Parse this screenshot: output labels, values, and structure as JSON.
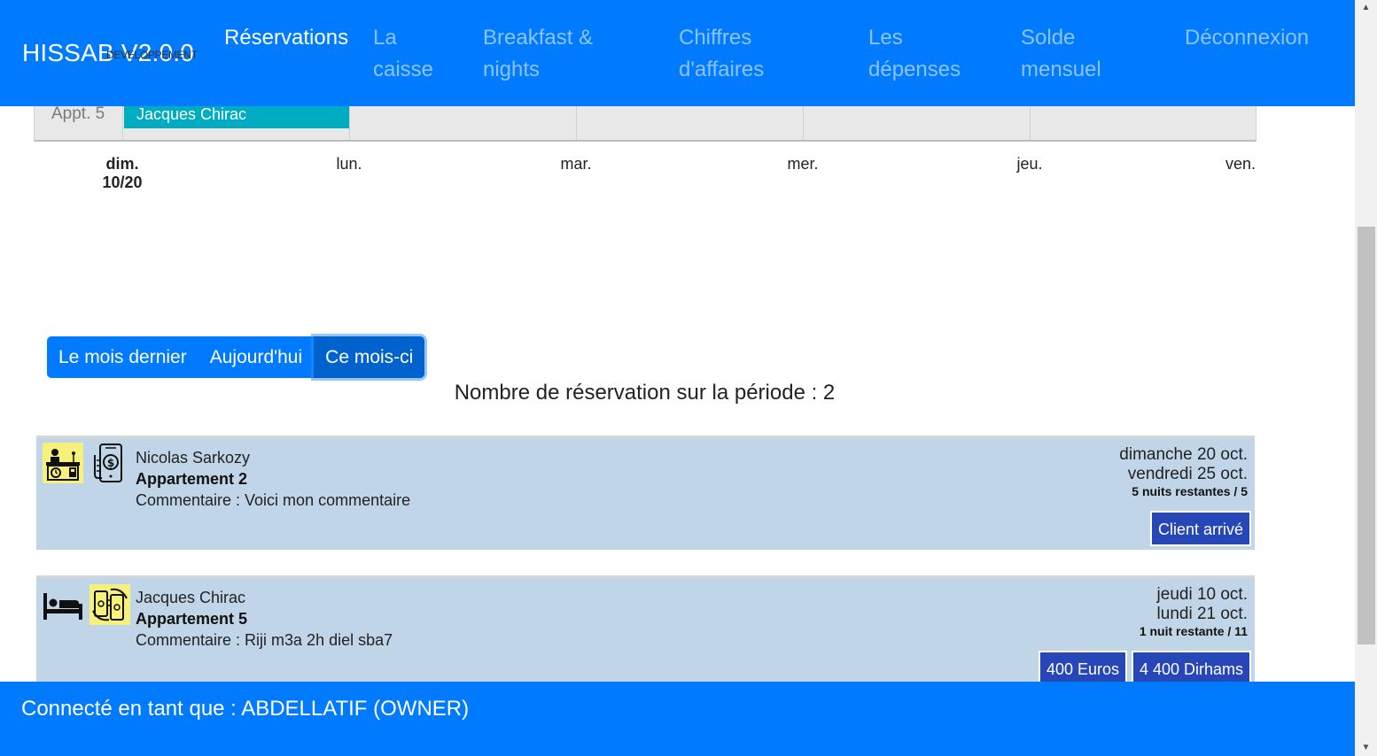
{
  "app": {
    "brand": "HISSAB V2.0.0",
    "brand_sub": "DEVELOPPEMENT"
  },
  "nav": {
    "items": [
      {
        "label_line1": "Réservations",
        "label_line2": ""
      },
      {
        "label_line1": "La",
        "label_line2": "caisse"
      },
      {
        "label_line1": "Breakfast &",
        "label_line2": "nights"
      },
      {
        "label_line1": "Chiffres",
        "label_line2": "d'affaires"
      },
      {
        "label_line1": "Les",
        "label_line2": "dépenses"
      },
      {
        "label_line1": "Solde",
        "label_line2": "mensuel"
      },
      {
        "label_line1": "Déconnexion",
        "label_line2": ""
      }
    ]
  },
  "timeline": {
    "row_label": "Appt. 5",
    "booking_label": "Jacques Chirac",
    "days": [
      {
        "name": "dim.",
        "date": "10/20"
      },
      {
        "name": "lun.",
        "date": ""
      },
      {
        "name": "mar.",
        "date": ""
      },
      {
        "name": "mer.",
        "date": ""
      },
      {
        "name": "jeu.",
        "date": ""
      },
      {
        "name": "ven.",
        "date": ""
      }
    ]
  },
  "period": {
    "buttons": [
      "Le mois dernier",
      "Aujourd'hui",
      "Ce mois-ci"
    ],
    "active": "Ce mois-ci",
    "count_text": "Nombre de réservation sur la période : 2"
  },
  "reservations": [
    {
      "client": "Nicolas Sarkozy",
      "apartment": "Appartement 2",
      "comment": "Commentaire : Voici mon commentaire",
      "start": "dimanche 20 oct.",
      "end": "vendredi 25 oct.",
      "nights": "5 nuits restantes / 5",
      "buttons": [
        "Client arrivé"
      ],
      "icons": [
        "reception-desk-icon",
        "mobile-payment-icon"
      ]
    },
    {
      "client": "Jacques Chirac",
      "apartment": "Appartement 5",
      "comment": "Commentaire : Riji m3a 2h diel sba7",
      "start": "jeudi 10 oct.",
      "end": "lundi 21 oct.",
      "nights": "1 nuit restante / 11",
      "buttons": [
        "400 Euros",
        "4 400 Dirhams"
      ],
      "icons": [
        "bed-icon",
        "cash-payment-icon"
      ]
    }
  ],
  "footer": {
    "text": "Connecté en tant que : ABDELLATIF (OWNER)"
  },
  "colors": {
    "primary": "#007bff",
    "card_bg": "#c0d5e8",
    "booking_bar": "#00acc1",
    "action_button": "#2747b8",
    "icon_highlight": "#f7f07a"
  }
}
